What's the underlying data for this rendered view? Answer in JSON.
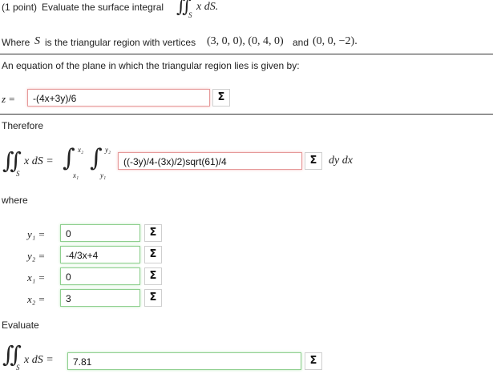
{
  "problem": {
    "points": "(1 point)",
    "prompt": "Evaluate the surface integral",
    "integral_integrand": "x dS.",
    "where_prefix": "Where",
    "where_var": "S",
    "where_mid": "is the triangular region with vertices",
    "vertices": "(3, 0, 0), (0, 4, 0)",
    "vertices_and": "and",
    "vertex_last": "(0, 0, −2).",
    "subscript_S": "S"
  },
  "plane": {
    "label": "An equation of the plane in which the triangular region lies is given by:",
    "lhs": "z =",
    "value": "-(4x+3y)/6",
    "sigma": "Σ"
  },
  "therefore": {
    "label": "Therefore",
    "lhs": "x dS =",
    "upper_outer": "x₂",
    "lower_outer": "x₁",
    "upper_inner": "y₂",
    "lower_inner": "y₁",
    "integrand_value": "((-3y)/4-(3x)/2)sqrt(61)/4",
    "differentials": "dy dx",
    "sigma": "Σ"
  },
  "where": {
    "label": "where",
    "rows": [
      {
        "lhs": "y₁ =",
        "value": "0",
        "sigma": "Σ"
      },
      {
        "lhs": "y₂ =",
        "value": "-4/3x+4",
        "sigma": "Σ"
      },
      {
        "lhs": "x₁ =",
        "value": "0",
        "sigma": "Σ"
      },
      {
        "lhs": "x₂ =",
        "value": "3",
        "sigma": "Σ"
      }
    ]
  },
  "evaluate": {
    "label": "Evaluate",
    "lhs": "x dS =",
    "value": "7.81",
    "sigma": "Σ"
  }
}
